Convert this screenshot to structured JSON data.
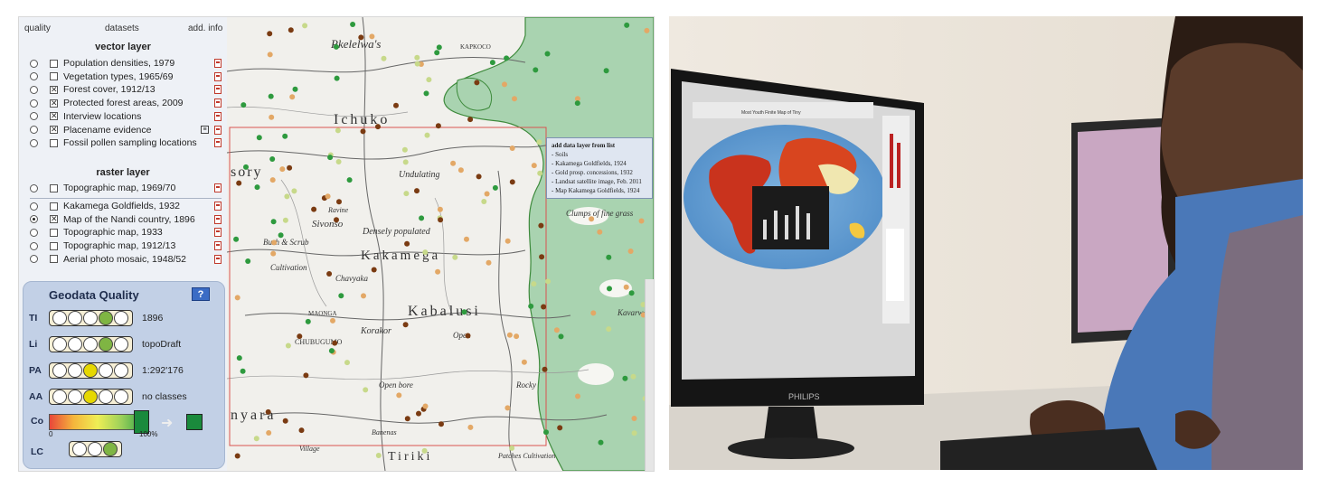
{
  "panel": {
    "headers": {
      "quality": "quality",
      "datasets": "datasets",
      "info": "add. info"
    },
    "vector_title": "vector layer",
    "vector_layers": [
      {
        "label": "Population densities, 1979",
        "checked": false
      },
      {
        "label": "Vegetation types, 1965/69",
        "checked": false
      },
      {
        "label": "Forest cover, 1912/13",
        "checked": true
      },
      {
        "label": "Protected forest areas, 2009",
        "checked": true
      },
      {
        "label": "Interview locations",
        "checked": true
      },
      {
        "label": "Placename evidence",
        "checked": true,
        "has_info_icon": true
      },
      {
        "label": "Fossil pollen sampling locations",
        "checked": false
      }
    ],
    "raster_title": "raster layer",
    "raster_layers": [
      {
        "label": "Topographic map, 1969/70",
        "checked": false,
        "selected": false
      },
      {
        "label": "Kakamega Goldfields, 1932",
        "checked": false,
        "selected": false
      },
      {
        "label": "Map of the Nandi country, 1896",
        "checked": true,
        "selected": true
      },
      {
        "label": "Topographic map, 1933",
        "checked": false,
        "selected": false
      },
      {
        "label": "Topographic map, 1912/13",
        "checked": false,
        "selected": false
      },
      {
        "label": "Aerial photo mosaic, 1948/52",
        "checked": false,
        "selected": false
      }
    ]
  },
  "quality": {
    "title": "Geodata Quality",
    "help": "?",
    "rows": [
      {
        "code": "TI",
        "value": "1896",
        "level": 4,
        "color": "green"
      },
      {
        "code": "Li",
        "value": "topoDraft",
        "level": 4,
        "color": "green"
      },
      {
        "code": "PA",
        "value": "1:292'176",
        "level": 3,
        "color": "yellow"
      },
      {
        "code": "AA",
        "value": "no classes",
        "level": 3,
        "color": "yellow"
      }
    ],
    "co_label": "Co",
    "co_min": "0",
    "co_max": "100%",
    "co_value": 1.0,
    "lc_label": "LC",
    "lc_level": 3
  },
  "map": {
    "labels": [
      "Rkelelwa's",
      "KAPKOCO",
      "Ichuko",
      "sory",
      "Undulating",
      "Ravine",
      "Sivonso",
      "Densely populated",
      "Bush & Scrub",
      "Kakamega",
      "Cultivation",
      "Chavyaka",
      "Kabalusi",
      "MAONGA",
      "Korakor",
      "CHUBUGUMO",
      "Open",
      "Rocky",
      "Open bore",
      "nyara",
      "Banenas",
      "Tiriki",
      "Clumps of fine grass",
      "Patches Cultivation",
      "Village",
      "Kavarwa"
    ]
  },
  "tooltip": {
    "title": "add data layer from list",
    "items": [
      "- Soils",
      "- Kakamega Goldfields, 1924",
      "- Gold prosp. concessions, 1932",
      "- Landsat satellite image, Feb. 2011",
      "- Map Kakamega Goldfields, 1924"
    ]
  },
  "photo": {
    "screen_title": "Most Youth Finite Map of Tiny",
    "monitor_brand": "PHILIPS"
  },
  "colors": {
    "panel_bg": "#eef1f6",
    "quality_bg": "#c2d0e6",
    "forest_green": "#a9d3b0",
    "dot_orange": "#e3a866",
    "dot_green": "#2e9a3e",
    "dot_brown": "#7a3b12"
  }
}
